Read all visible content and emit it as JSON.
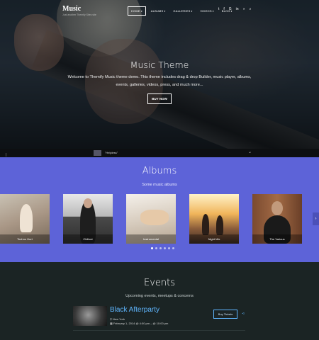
{
  "header": {
    "logo": "Music",
    "tagline": "Just another Themify Sites site",
    "nav": [
      {
        "label": "HOME",
        "chevron": true,
        "active": true
      },
      {
        "label": "ALBUMS",
        "chevron": true,
        "active": false
      },
      {
        "label": "GALLERIES",
        "chevron": true,
        "active": false
      },
      {
        "label": "VIDEOS",
        "chevron": true,
        "active": false
      },
      {
        "label": "BLOG",
        "chevron": true,
        "active": false
      }
    ],
    "social": [
      "twitter-icon",
      "facebook-icon",
      "google-plus-icon",
      "linkedin-icon",
      "rss-icon",
      "search-icon"
    ]
  },
  "hero": {
    "title": "Music Theme",
    "description": "Welcome to Themify Music theme demo. This theme includes drag & drop Builder, music player, albums, events, galleries, videos, press, and much more...",
    "button": "BUY NOW"
  },
  "player": {
    "track": "\"Helpless\""
  },
  "albums": {
    "title": "Albums",
    "subtitle": "Some music albums",
    "items": [
      {
        "title": "Techno Hurt"
      },
      {
        "title": "Chillout"
      },
      {
        "title": "Instrumental"
      },
      {
        "title": "Night Mix"
      },
      {
        "title": "The Various"
      }
    ],
    "pagination_dots": 6,
    "active_dot": 0
  },
  "events": {
    "title": "Events",
    "subtitle": "Upcoming events, meetups & concerns",
    "items": [
      {
        "name": "Black Afterparty",
        "location": "New York",
        "date": "February 1, 2014 @ 4:00 pm – @ 10:00 pm",
        "button": "Buy Tickets"
      }
    ]
  },
  "colors": {
    "albums_bg": "#5d63d8",
    "events_bg": "#1b2424",
    "event_accent": "#5fb6ff"
  }
}
